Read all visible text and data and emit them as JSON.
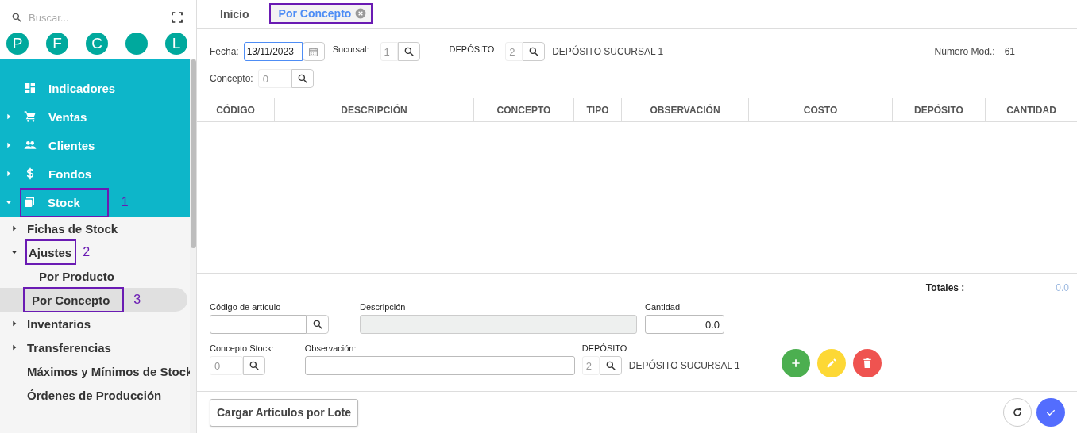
{
  "sidebar": {
    "search": {
      "placeholder": "Buscar..."
    },
    "avatars": [
      {
        "kind": "letter",
        "letter": "P"
      },
      {
        "kind": "letter",
        "letter": "F"
      },
      {
        "kind": "letter",
        "letter": "C"
      },
      {
        "kind": "blank"
      },
      {
        "kind": "letter",
        "letter": "L"
      }
    ],
    "menu": [
      {
        "kind": "link",
        "label": "Indicadores",
        "selected": false
      },
      {
        "kind": "group",
        "label": "Ventas",
        "expanded": false
      },
      {
        "kind": "group",
        "label": "Clientes",
        "expanded": false
      },
      {
        "kind": "group",
        "label": "Fondos",
        "expanded": false
      },
      {
        "kind": "group",
        "label": "Stock",
        "expanded": true,
        "callout": "1",
        "children": [
          {
            "kind": "group",
            "label": "Fichas de Stock",
            "expanded": false
          },
          {
            "kind": "group",
            "label": "Ajustes",
            "expanded": true,
            "callout": "2",
            "children": [
              {
                "kind": "link",
                "label": "Por Producto",
                "selected": false
              },
              {
                "kind": "link",
                "label": "Por Concepto",
                "selected": true,
                "callout": "3"
              }
            ]
          },
          {
            "kind": "group",
            "label": "Inventarios",
            "expanded": false
          },
          {
            "kind": "group",
            "label": "Transferencias",
            "expanded": false
          },
          {
            "kind": "link",
            "label": "Máximos y Mínimos de Stock",
            "selected": false
          },
          {
            "kind": "link",
            "label": "Órdenes de Producción",
            "selected": false
          }
        ]
      }
    ]
  },
  "tabs": [
    {
      "label": "Inicio",
      "selected": false,
      "closable": false,
      "outlined": false
    },
    {
      "label": "Por Concepto",
      "selected": true,
      "closable": true,
      "outlined": true
    }
  ],
  "header": {
    "fecha": {
      "label": "Fecha:",
      "value": "13/11/2023"
    },
    "sucursal": {
      "label": "Sucursal:",
      "value": "1"
    },
    "deposito": {
      "label": "DEPÓSITO",
      "value": "2",
      "name": "DEPÓSITO SUCURSAL 1"
    },
    "numero_mod": {
      "label": "Número Mod.:",
      "value": "61"
    },
    "concepto": {
      "label": "Concepto:",
      "value": "0"
    }
  },
  "table": {
    "columns": [
      "CÓDIGO",
      "DESCRIPCIÓN",
      "CONCEPTO",
      "TIPO",
      "OBSERVACIÓN",
      "COSTO",
      "DEPÓSITO",
      "CANTIDAD"
    ]
  },
  "totals": {
    "label": "Totales :",
    "value": "0.0"
  },
  "entry": {
    "codigo": {
      "label": "Código de artículo"
    },
    "descripcion": {
      "label": "Descripción",
      "disabled": true
    },
    "cantidad": {
      "label": "Cantidad",
      "value": "0.0"
    },
    "concepto_stock": {
      "label": "Concepto Stock:",
      "value": "0"
    },
    "observacion": {
      "label": "Observación:"
    },
    "deposito": {
      "label": "DEPÓSITO",
      "value": "2",
      "name": "DEPÓSITO SUCURSAL 1"
    },
    "actions": [
      {
        "kind": "add"
      },
      {
        "kind": "edit"
      },
      {
        "kind": "delete"
      }
    ]
  },
  "footer": {
    "button": "Cargar Artículos por Lote",
    "actions": [
      {
        "kind": "refresh"
      },
      {
        "kind": "confirm"
      }
    ]
  }
}
